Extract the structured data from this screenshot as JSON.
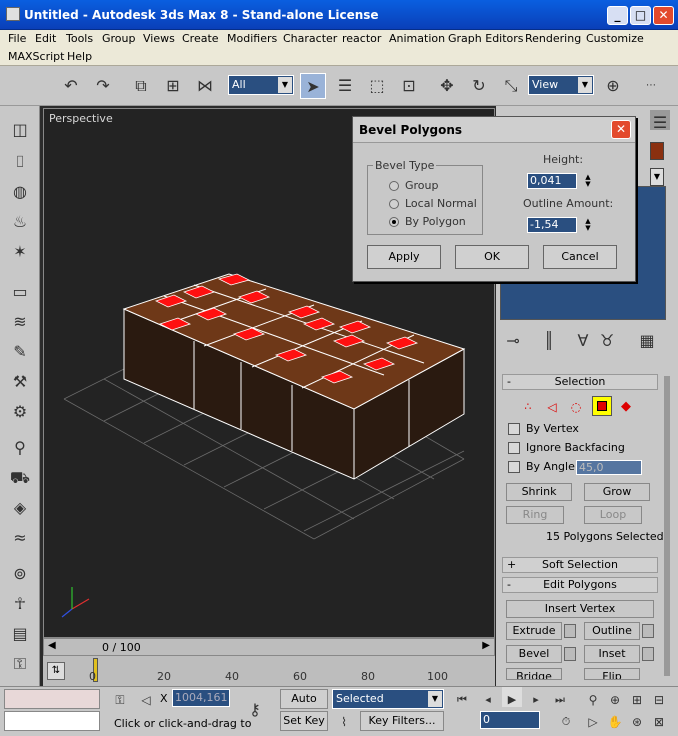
{
  "window": {
    "title": "Untitled - Autodesk 3ds Max 8  - Stand-alone License"
  },
  "menu": [
    "File",
    "Edit",
    "Tools",
    "Group",
    "Views",
    "Create",
    "Modifiers",
    "Character",
    "reactor",
    "Animation",
    "Graph Editors",
    "Rendering",
    "Customize",
    "MAXScript",
    "Help"
  ],
  "toolbar": {
    "selection_filter": "All",
    "ref_coord": "View"
  },
  "viewport": {
    "label": "Perspective"
  },
  "dialog": {
    "title": "Bevel Polygons",
    "bevel_type_label": "Bevel Type",
    "options": [
      "Group",
      "Local Normal",
      "By Polygon"
    ],
    "selected_option": "By Polygon",
    "height_label": "Height:",
    "height_value": "0,041",
    "outline_label": "Outline Amount:",
    "outline_value": "-1,54",
    "apply": "Apply",
    "ok": "OK",
    "cancel": "Cancel"
  },
  "panel": {
    "selection_header": "Selection",
    "by_vertex": "By Vertex",
    "ignore_backfacing": "Ignore Backfacing",
    "by_angle": "By Angle:",
    "by_angle_value": "45,0",
    "shrink": "Shrink",
    "grow": "Grow",
    "ring": "Ring",
    "loop": "Loop",
    "selected_count": "15 Polygons Selected",
    "soft_selection": "Soft Selection",
    "edit_polygons": "Edit Polygons",
    "insert_vertex": "Insert Vertex",
    "extrude": "Extrude",
    "outline": "Outline",
    "bevel": "Bevel",
    "inset": "Inset",
    "bridge": "Bridge",
    "flip": "Flip"
  },
  "timeline": {
    "position": "0 / 100",
    "ticks": [
      "0",
      "20",
      "40",
      "60",
      "80",
      "100"
    ]
  },
  "status": {
    "coord_x": "1004,161",
    "auto_key": "Auto Key",
    "set_key": "Set Key",
    "key_mode": "Selected",
    "key_filters": "Key Filters...",
    "frame": "0",
    "prompt": "Click or click-and-drag to"
  },
  "colors": {
    "titlebar": "#0a4fd0",
    "accent": "#2a4f80",
    "brick": "#5a2e14",
    "face": "#ff0000"
  }
}
